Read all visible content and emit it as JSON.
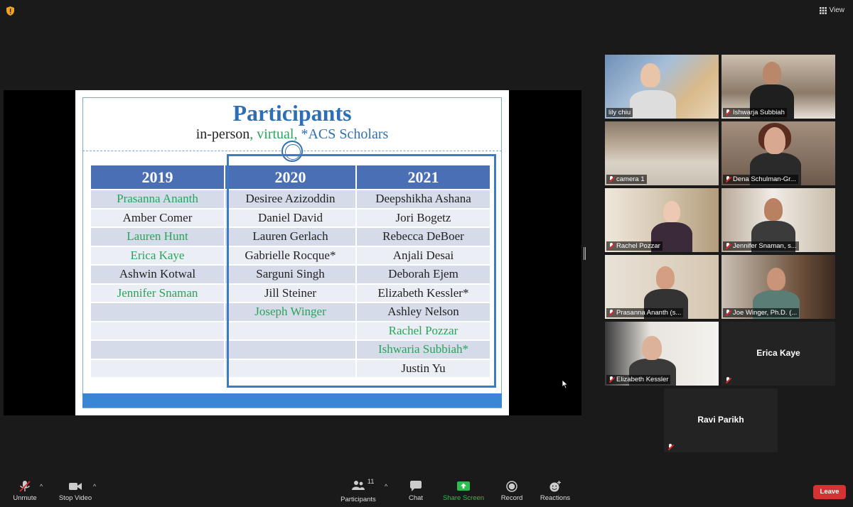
{
  "topbar": {
    "view_label": "View"
  },
  "slide": {
    "title": "Participants",
    "subtitle_inperson": "in-person",
    "subtitle_sep1": ", ",
    "subtitle_virtual": "virtual",
    "subtitle_sep2": ", ",
    "subtitle_acs": "*ACS Scholars",
    "columns": [
      "2019",
      "2020",
      "2021"
    ],
    "rows": [
      [
        {
          "t": "Prasanna Ananth",
          "g": true
        },
        {
          "t": "Desiree Azizoddin",
          "g": false
        },
        {
          "t": "Deepshikha Ashana",
          "g": false
        }
      ],
      [
        {
          "t": "Amber Comer",
          "g": false
        },
        {
          "t": "Daniel David",
          "g": false
        },
        {
          "t": "Jori Bogetz",
          "g": false
        }
      ],
      [
        {
          "t": "Lauren Hunt",
          "g": true
        },
        {
          "t": "Lauren Gerlach",
          "g": false
        },
        {
          "t": "Rebecca DeBoer",
          "g": false
        }
      ],
      [
        {
          "t": "Erica Kaye",
          "g": true
        },
        {
          "t": "Gabrielle Rocque*",
          "g": false
        },
        {
          "t": "Anjali Desai",
          "g": false
        }
      ],
      [
        {
          "t": "Ashwin Kotwal",
          "g": false
        },
        {
          "t": "Sarguni Singh",
          "g": false
        },
        {
          "t": "Deborah Ejem",
          "g": false
        }
      ],
      [
        {
          "t": "Jennifer Snaman",
          "g": true
        },
        {
          "t": "Jill Steiner",
          "g": false
        },
        {
          "t": "Elizabeth Kessler*",
          "g": false
        }
      ],
      [
        {
          "t": "",
          "g": false
        },
        {
          "t": "Joseph Winger",
          "g": true
        },
        {
          "t": "Ashley Nelson",
          "g": false
        }
      ],
      [
        {
          "t": "",
          "g": false
        },
        {
          "t": "",
          "g": false
        },
        {
          "t": "Rachel Pozzar",
          "g": true
        }
      ],
      [
        {
          "t": "",
          "g": false
        },
        {
          "t": "",
          "g": false
        },
        {
          "t": "Ishwaria Subbiah*",
          "g": true
        }
      ],
      [
        {
          "t": "",
          "g": false
        },
        {
          "t": "",
          "g": false
        },
        {
          "t": "Justin Yu",
          "g": false
        }
      ]
    ]
  },
  "gallery": [
    {
      "name": "lily chiu",
      "muted": false
    },
    {
      "name": "Ishwarja Subbiah",
      "muted": true
    },
    {
      "name": "camera 1",
      "muted": true
    },
    {
      "name": "Dena Schulman-Gr...",
      "muted": true
    },
    {
      "name": "Rachel Pozzar",
      "muted": true
    },
    {
      "name": "Jennifer Snaman, s...",
      "muted": true
    },
    {
      "name": "Prasanna Ananth (s...",
      "muted": true
    },
    {
      "name": "Joe Winger, Ph.D. (...",
      "muted": true
    },
    {
      "name": "Elizabeth Kessler",
      "muted": true
    },
    {
      "name": "Erica Kaye",
      "muted": true
    },
    {
      "name": "Ravi Parikh",
      "muted": true
    }
  ],
  "toolbar": {
    "unmute": "Unmute",
    "stop_video": "Stop Video",
    "participants": "Participants",
    "participants_count": "11",
    "chat": "Chat",
    "share_screen": "Share Screen",
    "record": "Record",
    "reactions": "Reactions",
    "leave": "Leave"
  },
  "colors": {
    "share_green": "#2dbd4f",
    "leave_red": "#d63233",
    "active_speaker": "#e8e82a"
  }
}
